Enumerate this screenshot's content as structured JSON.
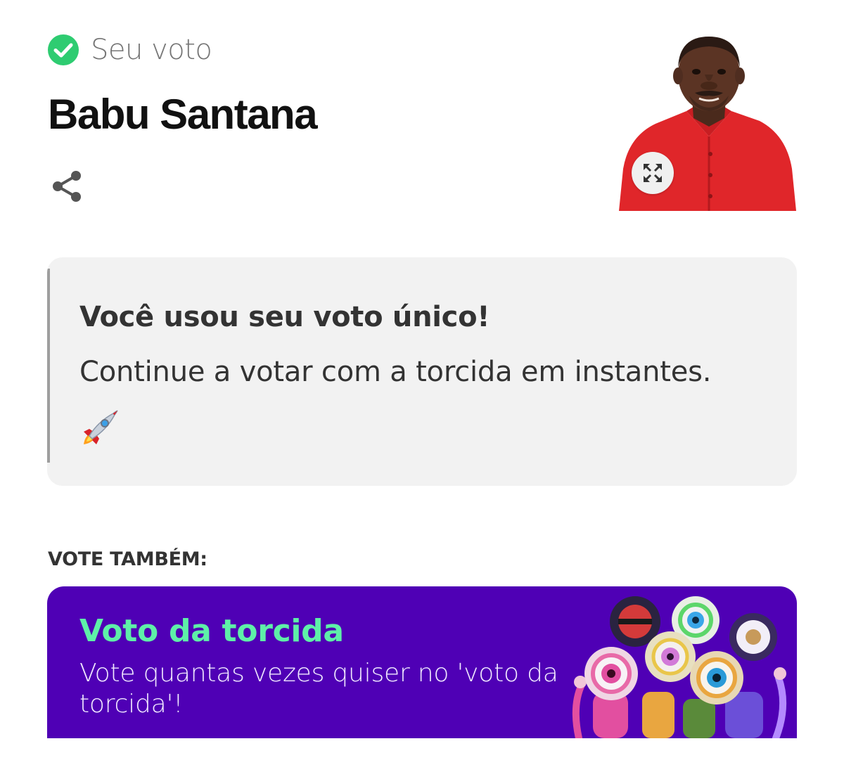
{
  "header": {
    "voted_label": "Seu voto",
    "candidate_name": "Babu Santana",
    "check_color": "#2ecc71"
  },
  "photo": {
    "icon": "photo-of-candidate",
    "expand_icon": "expand-icon"
  },
  "notice": {
    "title": "Você usou seu voto único!",
    "text": "Continue a votar com a torcida em instantes.",
    "emoji": "🚀"
  },
  "vote_also": {
    "heading": "VOTE TAMBÉM:",
    "card": {
      "title": "Voto da torcida",
      "text": "Vote quantas vezes quiser no 'voto da torcida'!",
      "background": "#4f00b5",
      "title_color": "#5ef0a8"
    }
  }
}
